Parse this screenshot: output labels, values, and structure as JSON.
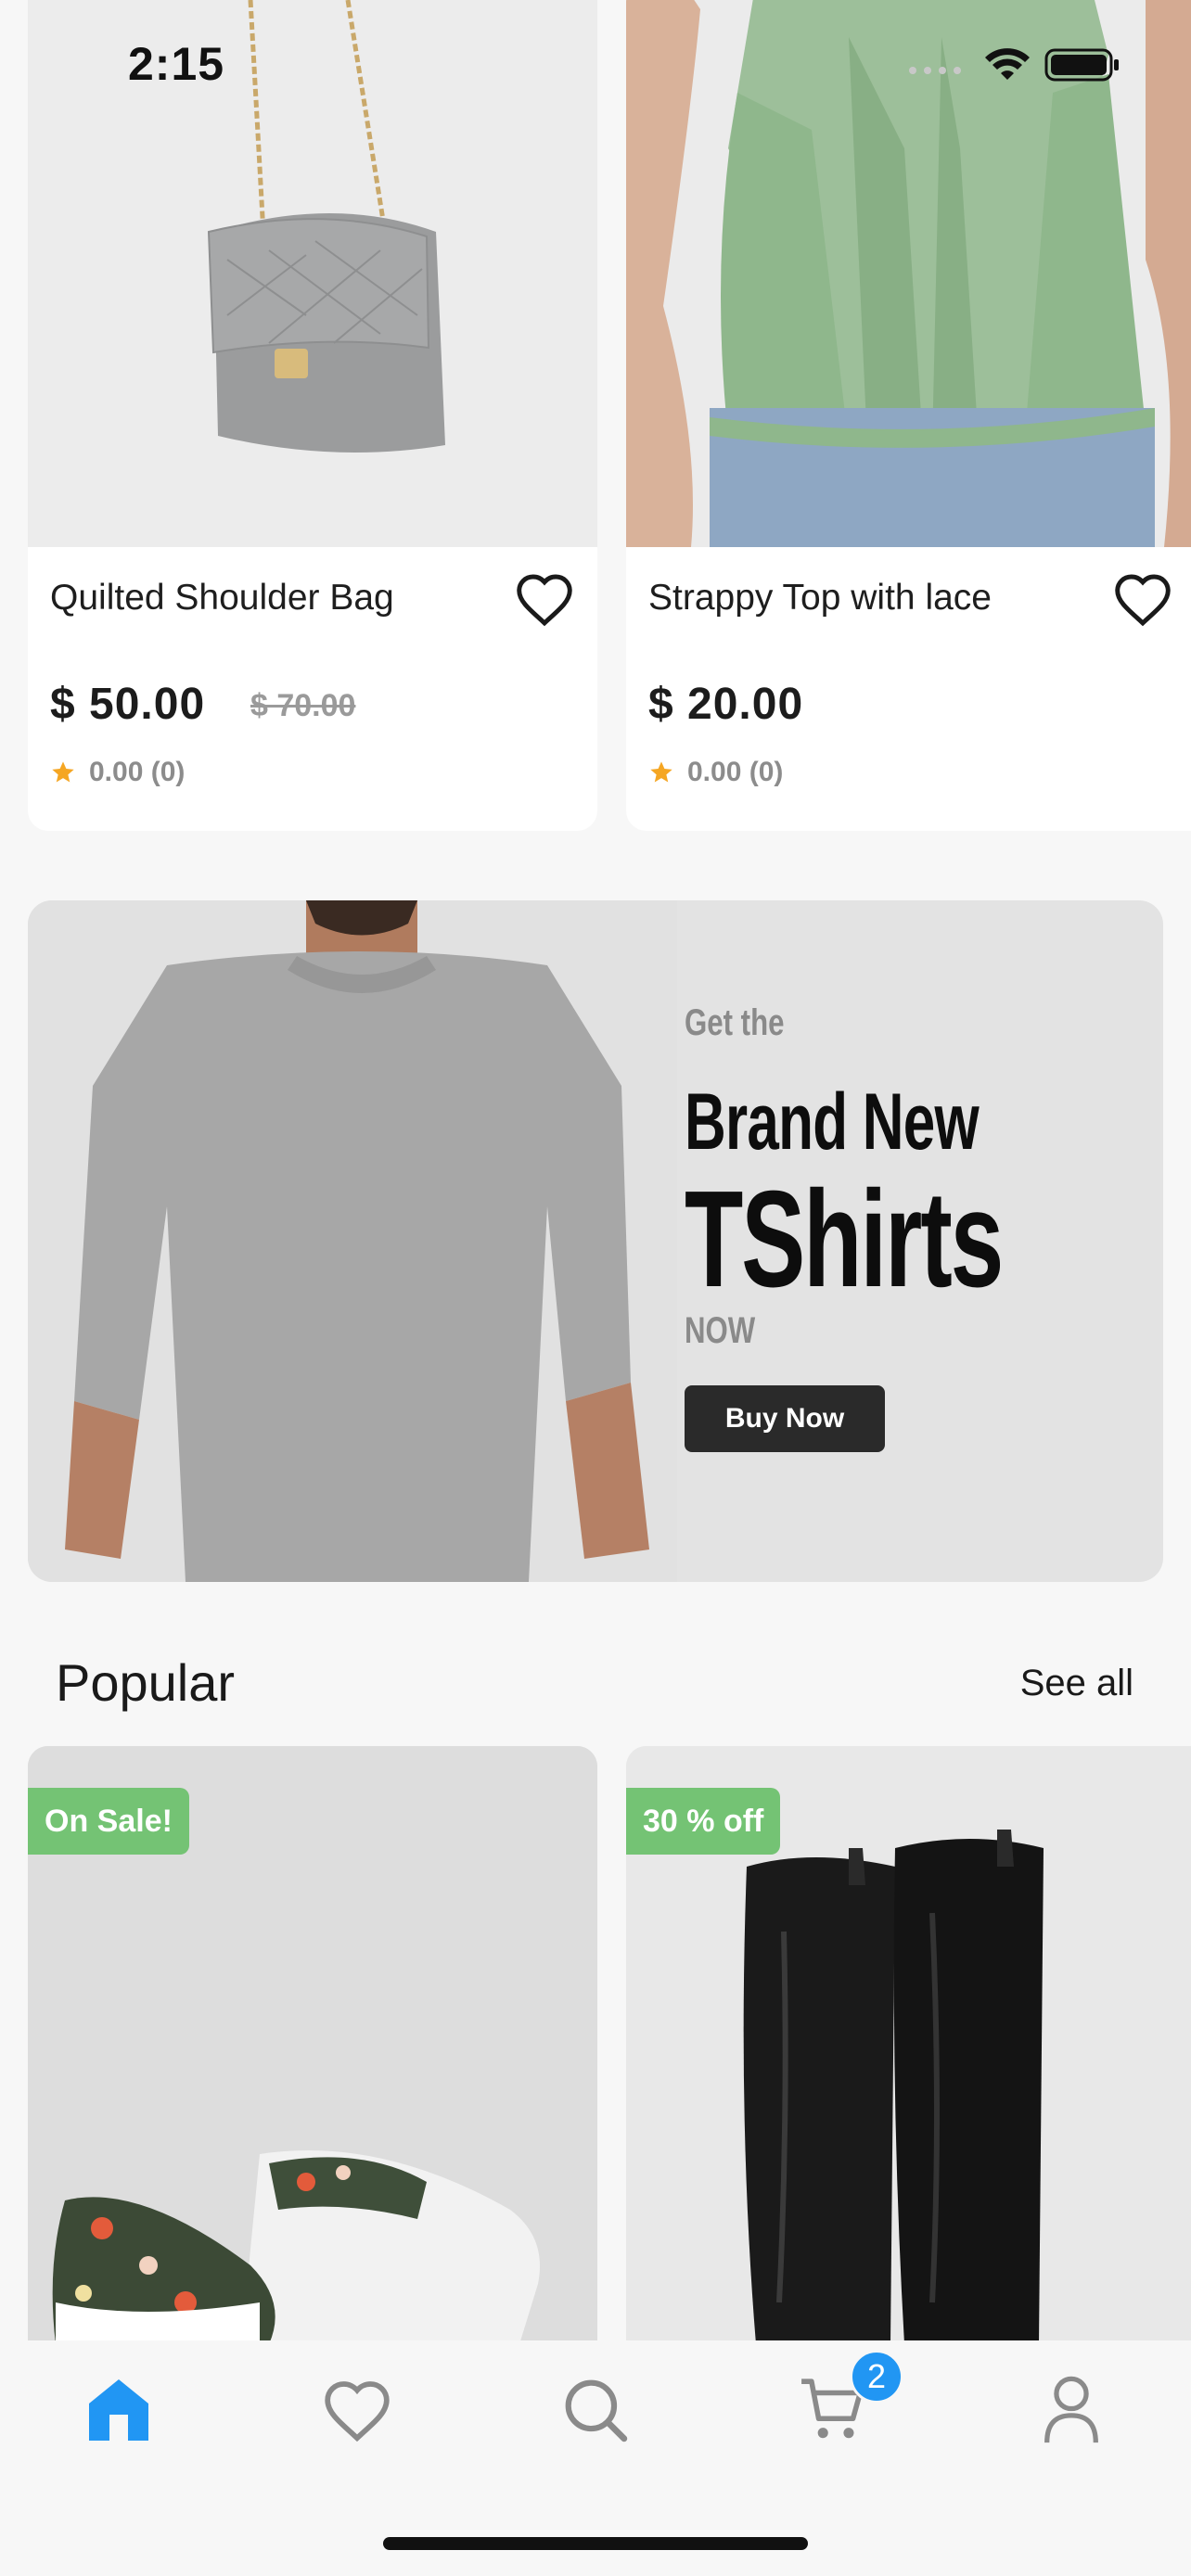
{
  "status": {
    "time": "2:15"
  },
  "products_top": [
    {
      "title": "Quilted Shoulder Bag",
      "price": "$ 50.00",
      "old_price": "$ 70.00",
      "rating": "0.00 (0)"
    },
    {
      "title": "Strappy Top with lace",
      "price": "$ 20.00",
      "rating": "0.00 (0)"
    }
  ],
  "banner": {
    "line1": "Get the",
    "line2": "Brand New",
    "line3": "TShirts",
    "line4": "NOW",
    "button": "Buy Now"
  },
  "popular": {
    "title": "Popular",
    "see_all": "See all",
    "items": [
      {
        "badge": "On Sale!"
      },
      {
        "badge": "30 % off"
      }
    ]
  },
  "tabbar": {
    "cart_count": "2"
  },
  "colors": {
    "accent": "#2196f3",
    "badge_green": "#74c374",
    "star": "#f5a623"
  }
}
